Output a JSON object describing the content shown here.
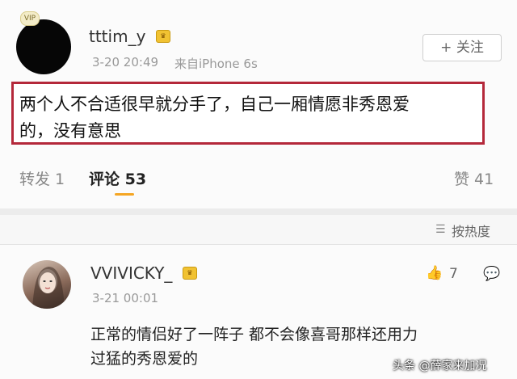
{
  "post": {
    "username": "tttim_y",
    "badge": "VIP",
    "timestamp": "3-20 20:49",
    "source": "来自iPhone 6s",
    "follow_label": "+ 关注",
    "text_line1": "两个人不合适很早就分手了，自己一厢情愿非秀恩爱",
    "text_line2": "的，没有意思"
  },
  "stats": {
    "repost": "转发 1",
    "comments": "评论 53",
    "likes": "赞 41"
  },
  "sort": {
    "label": "按热度",
    "icon": "sort-icon"
  },
  "comment": {
    "username": "VVIVICKY_",
    "timestamp": "3-21 00:01",
    "like_count": "7",
    "text_line1": "正常的情侣好了一阵子 都不会像喜哥那样还用力",
    "text_line2": "过猛的秀恩爱的"
  },
  "watermark": "头条 @薛家来加况",
  "colors": {
    "highlight_border": "#b4283a",
    "tab_accent": "#f5a623"
  }
}
